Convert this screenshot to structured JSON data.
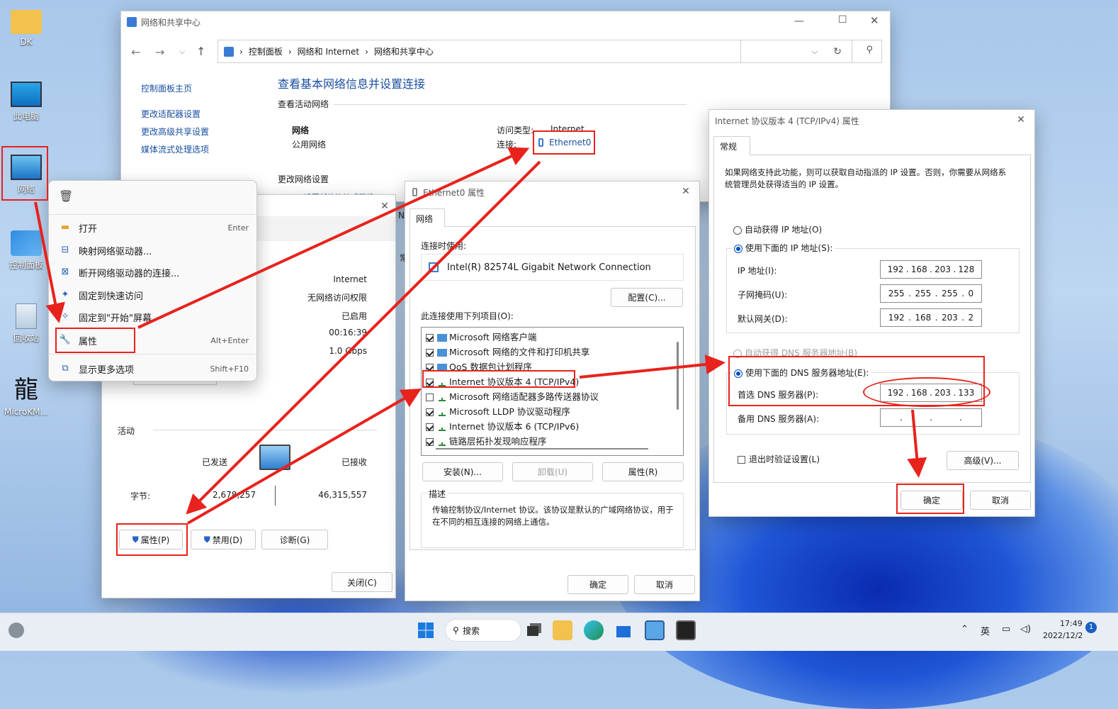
{
  "desktop": {
    "icons": [
      {
        "label": "DK"
      },
      {
        "label": "此电脑"
      },
      {
        "label": "网络"
      },
      {
        "label": "控制面板"
      },
      {
        "label": "回收站"
      },
      {
        "label": "MicroKM..."
      }
    ]
  },
  "ncsc": {
    "title": "网络和共享中心",
    "breadcrumb": [
      "控制面板",
      "网络和 Internet",
      "网络和共享中心"
    ],
    "sidebar": [
      "控制面板主页",
      "更改适配器设置",
      "更改高级共享设置",
      "媒体流式处理选项"
    ],
    "heading": "查看基本网络信息并设置连接",
    "active_label": "查看活动网络",
    "net_name": "网络",
    "net_type": "公用网络",
    "access_label": "访问类型:",
    "access_value": "Internet",
    "conn_label": "连接:",
    "conn_value": "Ethernet0",
    "change_label": "更改网络设置",
    "change_link": "设置新的连接或网络"
  },
  "context_menu": {
    "items": [
      {
        "label": "打开",
        "shortcut": "Enter"
      },
      {
        "label": "映射网络驱动器...",
        "shortcut": ""
      },
      {
        "label": "断开网络驱动器的连接...",
        "shortcut": ""
      },
      {
        "label": "固定到快速访问",
        "shortcut": ""
      },
      {
        "label": "固定到\"开始\"屏幕",
        "shortcut": ""
      },
      {
        "label": "属性",
        "shortcut": "Alt+Enter"
      },
      {
        "label": "显示更多选项",
        "shortcut": "Shift+F10"
      }
    ]
  },
  "status": {
    "partial_n": "N",
    "partial_g": "常",
    "values": [
      "Internet",
      "无网络访问权限",
      "已启用",
      "00:16:39",
      "1.0 Gbps"
    ],
    "activity": "活动",
    "sent": "已发送",
    "received": "已接收",
    "bytes_label": "字节:",
    "bytes_sent": "2,678,257",
    "bytes_recv": "46,315,557",
    "btn_props": "属性(P)",
    "btn_disable": "禁用(D)",
    "btn_diag": "诊断(G)",
    "btn_close": "关闭(C)"
  },
  "ethprops": {
    "title": "Ethernet0 属性",
    "tab": "网络",
    "connect_using": "连接时使用:",
    "adapter": "Intel(R) 82574L Gigabit Network Connection",
    "configure": "配置(C)...",
    "items_label": "此连接使用下列项目(O):",
    "items": [
      {
        "label": "Microsoft 网络客户端",
        "checked": true
      },
      {
        "label": "Microsoft 网络的文件和打印机共享",
        "checked": true
      },
      {
        "label": "QoS 数据包计划程序",
        "checked": true
      },
      {
        "label": "Internet 协议版本 4 (TCP/IPv4)",
        "checked": true
      },
      {
        "label": "Microsoft 网络适配器多路传送器协议",
        "checked": false
      },
      {
        "label": "Microsoft LLDP 协议驱动程序",
        "checked": true
      },
      {
        "label": "Internet 协议版本 6 (TCP/IPv6)",
        "checked": true
      },
      {
        "label": "链路层拓扑发现响应程序",
        "checked": true
      }
    ],
    "install": "安装(N)...",
    "uninstall": "卸载(U)",
    "properties": "属性(R)",
    "desc_label": "描述",
    "desc": "传输控制协议/Internet 协议。该协议是默认的广域网络协议，用于在不同的相互连接的网络上通信。",
    "ok": "确定",
    "cancel": "取消"
  },
  "ipv4": {
    "title": "Internet 协议版本 4 (TCP/IPv4) 属性",
    "tab": "常规",
    "intro": "如果网络支持此功能，则可以获取自动指派的 IP 设置。否则，你需要从网络系统管理员处获得适当的 IP 设置。",
    "auto_ip": "自动获得 IP 地址(O)",
    "manual_ip": "使用下面的 IP 地址(S):",
    "ip_label": "IP 地址(I):",
    "ip": [
      "192",
      "168",
      "203",
      "128"
    ],
    "mask_label": "子网掩码(U):",
    "mask": [
      "255",
      "255",
      "255",
      "0"
    ],
    "gw_label": "默认网关(D):",
    "gw": [
      "192",
      "168",
      "203",
      "2"
    ],
    "auto_dns": "自动获得 DNS 服务器地址(B)",
    "manual_dns": "使用下面的 DNS 服务器地址(E):",
    "dns1_label": "首选 DNS 服务器(P):",
    "dns1": [
      "192",
      "168",
      "203",
      "133"
    ],
    "dns2_label": "备用 DNS 服务器(A):",
    "validate": "退出时验证设置(L)",
    "advanced": "高级(V)...",
    "ok": "确定",
    "cancel": "取消"
  },
  "taskbar": {
    "search": "搜索",
    "ime": "英",
    "time": "17:49",
    "date": "2022/12/2",
    "badge": "1"
  }
}
